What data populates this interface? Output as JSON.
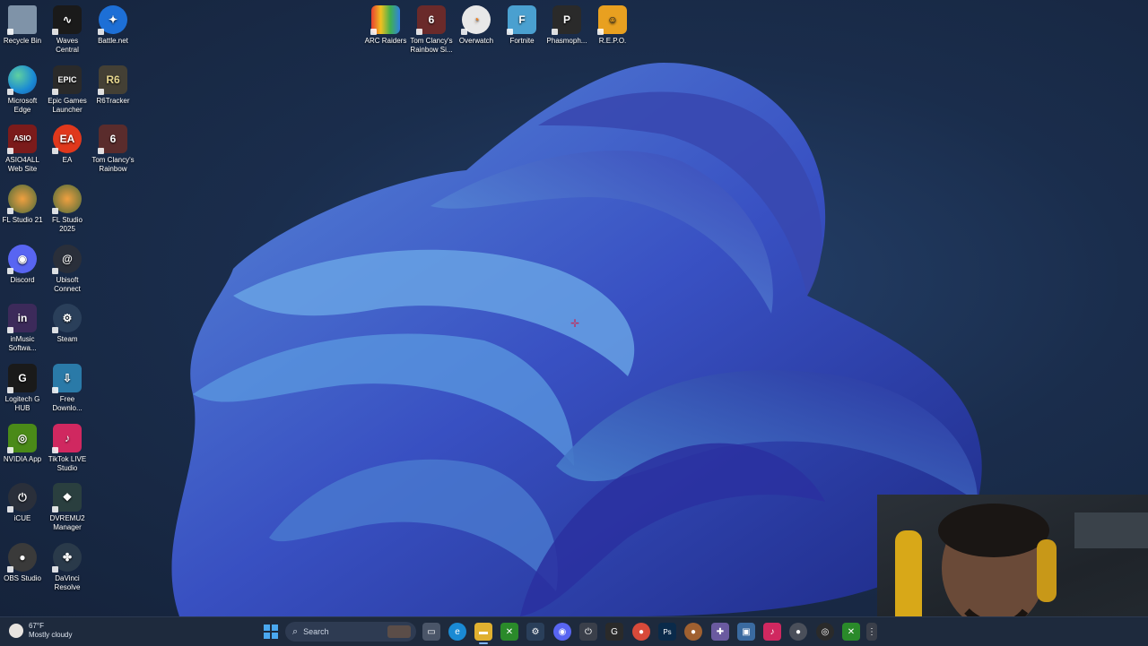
{
  "desktop": {
    "icons": [
      {
        "label": "Recycle Bin",
        "icon": "recycle-bin-icon",
        "bg": "#7f93a8"
      },
      {
        "label": "Waves Central",
        "icon": "waves-icon",
        "bg": "#1a1a1a"
      },
      {
        "label": "Battle.net",
        "icon": "battlenet-icon",
        "bg": "#1d6fd6"
      },
      {
        "label": "Microsoft Edge",
        "icon": "edge-icon",
        "bg": "#1a8ad4"
      },
      {
        "label": "Epic Games Launcher",
        "icon": "epic-games-icon",
        "bg": "#2a2a2a",
        "glyph": "EPIC"
      },
      {
        "label": "R6Tracker",
        "icon": "r6tracker-icon",
        "bg": "#444035",
        "glyph": "R6"
      },
      {
        "label": "ASIO4ALL Web Site",
        "icon": "asio4all-icon",
        "bg": "#7b1b1b",
        "glyph": "ASIO"
      },
      {
        "label": "EA",
        "icon": "ea-icon",
        "bg": "#e0381c",
        "glyph": "EA"
      },
      {
        "label": "Tom Clancy's Rainbow Six...",
        "icon": "rainbow-six-icon",
        "bg": "#5a2c2c",
        "glyph": "6"
      },
      {
        "label": "FL Studio 21",
        "icon": "fl-studio-21-icon",
        "bg": "#4a6a3a"
      },
      {
        "label": "FL Studio 2025",
        "icon": "fl-studio-2025-icon",
        "bg": "#4a6a3a"
      },
      {
        "label": "Discord",
        "icon": "discord-icon",
        "bg": "#5865f2"
      },
      {
        "label": "Ubisoft Connect",
        "icon": "ubisoft-icon",
        "bg": "#2a2f3a"
      },
      {
        "label": "inMusic Softwa...",
        "icon": "inmusic-icon",
        "bg": "#3c2a5a",
        "glyph": "in"
      },
      {
        "label": "Steam",
        "icon": "steam-icon",
        "bg": "#2a3f5a"
      },
      {
        "label": "Logitech G HUB",
        "icon": "logitech-ghub-icon",
        "bg": "#1a1a1a",
        "glyph": "G"
      },
      {
        "label": "Free Downlo...",
        "icon": "free-download-icon",
        "bg": "#2a7aa8"
      },
      {
        "label": "NVIDIA App",
        "icon": "nvidia-icon",
        "bg": "#4a8a18"
      },
      {
        "label": "TikTok LIVE Studio",
        "icon": "tiktok-live-icon",
        "bg": "#d02860"
      },
      {
        "label": "iCUE",
        "icon": "icue-icon",
        "bg": "#2a2f3a"
      },
      {
        "label": "DVREMU2 Manager",
        "icon": "dvremu-icon",
        "bg": "#2a3f3f"
      },
      {
        "label": "OBS Studio",
        "icon": "obs-icon",
        "bg": "#3a3a3a"
      },
      {
        "label": "DaVinci Resolve",
        "icon": "davinci-icon",
        "bg": "#2a3a4a"
      }
    ],
    "top_icons": [
      {
        "label": "ARC Raiders",
        "icon": "arc-raiders-icon",
        "bg": "#3a3a3a"
      },
      {
        "label": "Tom Clancy's Rainbow Si...",
        "icon": "rainbow-six-siege-icon",
        "bg": "#6a2a2a",
        "glyph": "6"
      },
      {
        "label": "Overwatch",
        "icon": "overwatch-icon",
        "bg": "#e8e8e8"
      },
      {
        "label": "Fortnite",
        "icon": "fortnite-icon",
        "bg": "#4aa0d0",
        "glyph": "F"
      },
      {
        "label": "Phasmoph...",
        "icon": "phasmophobia-icon",
        "bg": "#2a2a2a",
        "glyph": "P"
      },
      {
        "label": "R.E.P.O.",
        "icon": "repo-icon",
        "bg": "#e8a020"
      }
    ]
  },
  "taskbar": {
    "weather_temp": "67°F",
    "weather_desc": "Mostly cloudy",
    "search_placeholder": "Search",
    "apps": [
      {
        "icon": "windows-start-icon",
        "bg": "#3a8ee8"
      },
      {
        "icon": "task-view-icon",
        "bg": "#4a5568"
      },
      {
        "icon": "edge-taskbar-icon",
        "bg": "#1a8ad4"
      },
      {
        "icon": "file-explorer-icon",
        "bg": "#e0b030"
      },
      {
        "icon": "xbox-icon",
        "bg": "#2a8a2a"
      },
      {
        "icon": "steam-taskbar-icon",
        "bg": "#2a3f5a"
      },
      {
        "icon": "discord-taskbar-icon",
        "bg": "#5865f2"
      },
      {
        "icon": "icue-taskbar-icon",
        "bg": "#3a3f4a"
      },
      {
        "icon": "logitech-taskbar-icon",
        "bg": "#2a2a2a"
      },
      {
        "icon": "chrome-icon",
        "bg": "#d84a3a"
      },
      {
        "icon": "photoshop-icon",
        "bg": "#0a2a4a"
      },
      {
        "icon": "fl-studio-taskbar-icon",
        "bg": "#a06030"
      },
      {
        "icon": "game-controller-icon",
        "bg": "#6a5aa0"
      },
      {
        "icon": "app-window-icon",
        "bg": "#3a6aa0"
      },
      {
        "icon": "tiktok-taskbar-icon",
        "bg": "#d02860"
      },
      {
        "icon": "fortnite-taskbar-icon",
        "bg": "#4aa0d0"
      },
      {
        "icon": "mic-icon",
        "bg": "#4a4f5a"
      },
      {
        "icon": "obs-taskbar-icon",
        "bg": "#2a2a2a"
      },
      {
        "icon": "xbox-app-icon",
        "bg": "#2a8a2a"
      },
      {
        "icon": "overflow-icon",
        "bg": "#3a3f4a"
      }
    ]
  }
}
